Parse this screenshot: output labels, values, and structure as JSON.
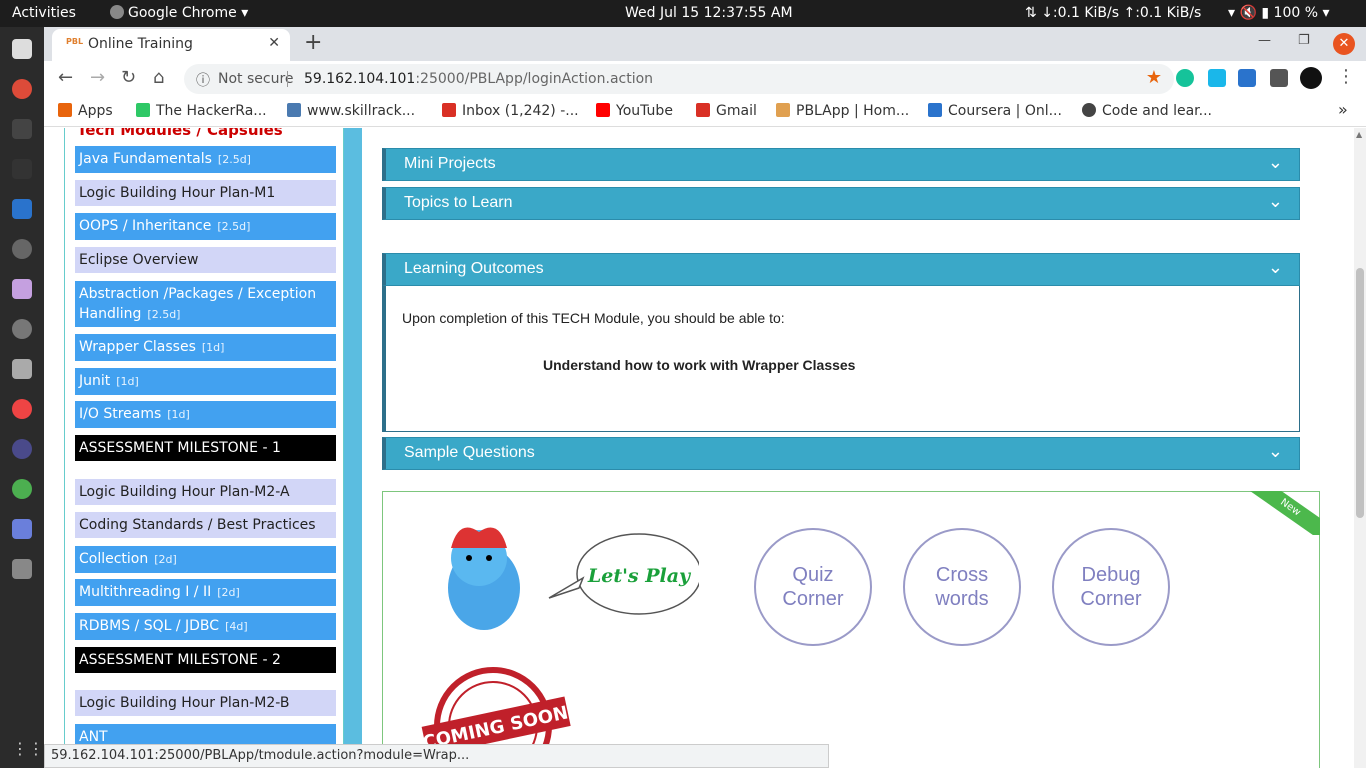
{
  "topbar": {
    "activities": "Activities",
    "app_name": "Google Chrome",
    "datetime": "Wed Jul 15  12:37:55 AM",
    "network": "↓:0.1 KiB/s ↑:0.1 KiB/s",
    "battery": "100 %"
  },
  "browser": {
    "tab_title": "Online Training",
    "favicon_text": "PBL",
    "not_secure": "Not secure",
    "url_host": "59.162.104.101",
    "url_rest": ":25000/PBLApp/loginAction.action",
    "new_tab": "+",
    "bookmarks": [
      {
        "label": "Apps",
        "color": "#e8640c"
      },
      {
        "label": "The HackerRa...",
        "color": "#2ec866"
      },
      {
        "label": "www.skillrack...",
        "color": "#4a7ab0"
      },
      {
        "label": "Inbox (1,242) -...",
        "color": "#d93025"
      },
      {
        "label": "YouTube",
        "color": "#ff0000"
      },
      {
        "label": "Gmail",
        "color": "#d93025"
      },
      {
        "label": "PBLApp | Hom...",
        "color": "#e0a050"
      },
      {
        "label": "Coursera | Onl...",
        "color": "#2a73cc"
      },
      {
        "label": "Code and lear...",
        "color": "#444444"
      }
    ],
    "more": "»",
    "status_url": "59.162.104.101:25000/PBLApp/tmodule.action?module=Wrap..."
  },
  "sidebar": {
    "heading": "Tech Modules / Capsules",
    "items": [
      {
        "label": "Java Fundamentals",
        "dur": "[2.5d]",
        "style": "blue"
      },
      {
        "label": "Logic Building Hour Plan-M1",
        "dur": "",
        "style": "lite"
      },
      {
        "label": "OOPS / Inheritance",
        "dur": "[2.5d]",
        "style": "blue"
      },
      {
        "label": "Eclipse Overview",
        "dur": "",
        "style": "lite"
      },
      {
        "label": "Abstraction /Packages / Exception Handling",
        "dur": "[2.5d]",
        "style": "blue"
      },
      {
        "label": "Wrapper Classes",
        "dur": "[1d]",
        "style": "blue"
      },
      {
        "label": "Junit",
        "dur": "[1d]",
        "style": "blue"
      },
      {
        "label": " I/O Streams",
        "dur": "[1d]",
        "style": "blue"
      },
      {
        "label": "ASSESSMENT MILESTONE - 1",
        "dur": "",
        "style": "dark"
      },
      {
        "label": "Logic Building Hour Plan-M2-A",
        "dur": "",
        "style": "lite"
      },
      {
        "label": "Coding Standards / Best Practices",
        "dur": "",
        "style": "lite"
      },
      {
        "label": "Collection",
        "dur": "[2d]",
        "style": "blue"
      },
      {
        "label": "Multithreading I / II",
        "dur": "[2d]",
        "style": "blue"
      },
      {
        "label": "RDBMS / SQL / JDBC",
        "dur": "[4d]",
        "style": "blue"
      },
      {
        "label": "ASSESSMENT MILESTONE - 2",
        "dur": "",
        "style": "dark"
      },
      {
        "label": "Logic Building Hour Plan-M2-B",
        "dur": "",
        "style": "lite"
      },
      {
        "label": "ANT",
        "dur": "",
        "style": "blue"
      }
    ]
  },
  "main": {
    "accordions": [
      {
        "label": "Mini Projects"
      },
      {
        "label": "Topics to Learn"
      },
      {
        "label": "Learning Outcomes"
      },
      {
        "label": "Sample Questions"
      }
    ],
    "outcome_intro": "Upon completion of this TECH Module, you should be able to:",
    "outcome_point": "Understand how to work with Wrapper Classes",
    "games": {
      "ribbon": "New",
      "lets_play": "Let's Play",
      "coming_soon": "COMING SOON",
      "quiz": "Quiz Corner",
      "cross": "Cross words",
      "debug": "Debug Corner"
    }
  }
}
